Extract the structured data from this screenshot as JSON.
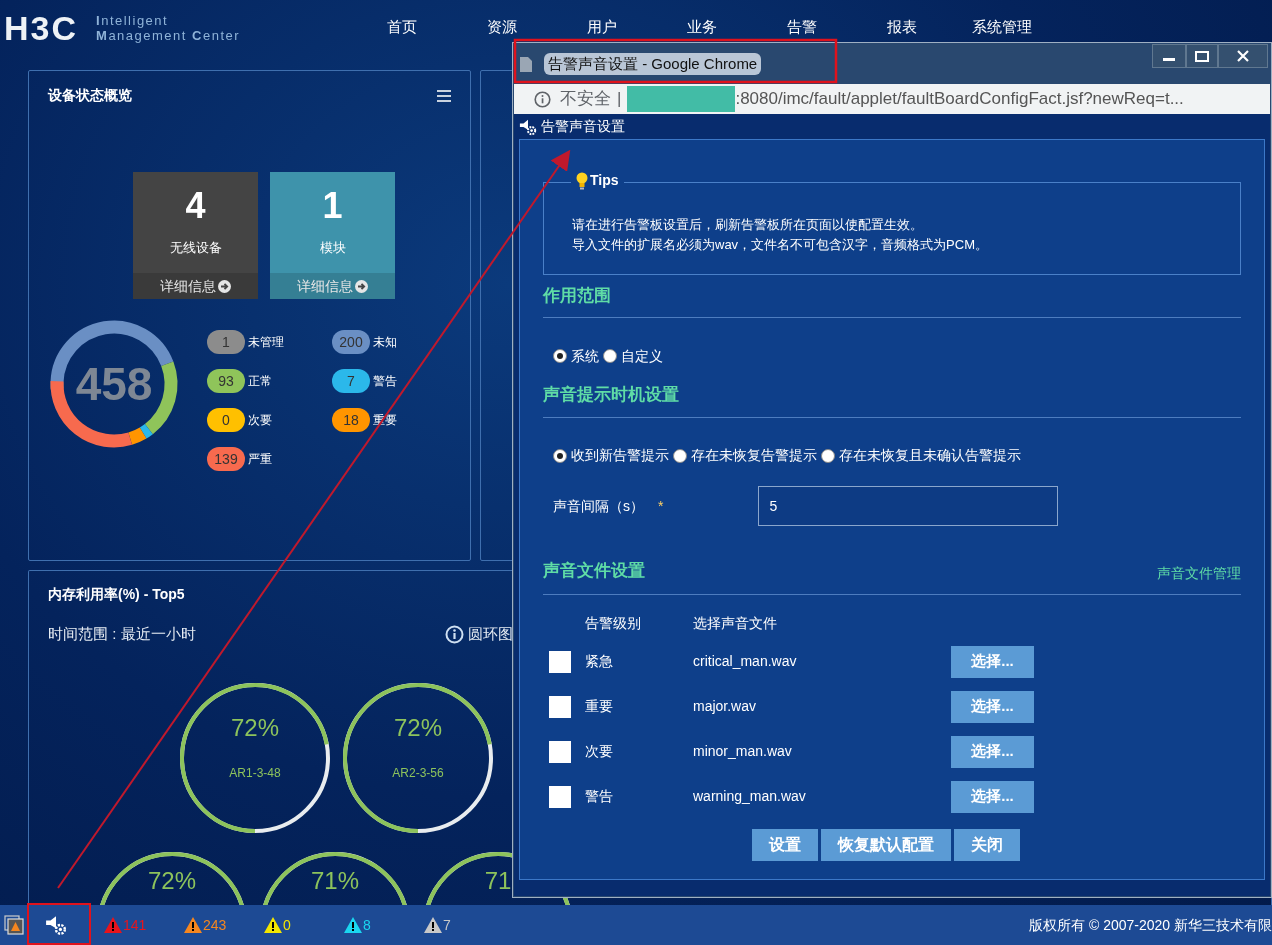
{
  "header": {
    "logo": "H3C",
    "product_lines": [
      "**I**ntelligent",
      "**M**anagement **C**enter"
    ],
    "nav": [
      "首页",
      "资源",
      "用户",
      "业务",
      "告警",
      "报表",
      "系统管理"
    ]
  },
  "device_overview": {
    "title": "设备状态概览",
    "tiles": [
      {
        "count": "4",
        "label": "无线设备",
        "link": "详细信息",
        "color": "#444444"
      },
      {
        "count": "1",
        "label": "模块",
        "link": "详细信息",
        "color": "#3e93ab"
      }
    ],
    "total": "458",
    "legend": [
      {
        "count": "1",
        "label": "未管理",
        "color": "#8c8c8c"
      },
      {
        "count": "200",
        "label": "未知",
        "color": "#6a8fc4"
      },
      {
        "count": "93",
        "label": "正常",
        "color": "#8fc45a"
      },
      {
        "count": "7",
        "label": "警告",
        "color": "#2bb8ea"
      },
      {
        "count": "0",
        "label": "次要",
        "color": "#ffc000"
      },
      {
        "count": "18",
        "label": "重要",
        "color": "#ff9500"
      },
      {
        "count": "139",
        "label": "严重",
        "color": "#f76a4e"
      }
    ]
  },
  "memory_panel": {
    "title": "内存利用率(%) - Top5",
    "time_range": "时间范围 : 最近一小时",
    "view_toggle": "圆环图",
    "gauge_rows": [
      [
        {
          "percent": "72%",
          "label": "AR1-3-48"
        },
        {
          "percent": "72%",
          "label": "AR2-3-56"
        }
      ],
      [
        {
          "percent": "72%"
        },
        {
          "percent": "71%"
        },
        {
          "percent": "71"
        }
      ]
    ]
  },
  "status_bar": {
    "alarms": [
      {
        "count": "141",
        "color": "#e8141c"
      },
      {
        "count": "243",
        "color": "#f5861f"
      },
      {
        "count": "0",
        "color": "#f2e600"
      },
      {
        "count": "8",
        "color": "#1ad6f0"
      },
      {
        "count": "7",
        "color": "#c8c8c8"
      }
    ],
    "copyright": "版权所有 © 2007-2020 新华三技术有限"
  },
  "popup": {
    "window_title": "告警声音设置 - Google Chrome",
    "address": {
      "security": "不安全",
      "separator": "|",
      "url": ":8080/imc/fault/applet/faultBoardConfigFact.jsf?newReq=t..."
    },
    "page_title": "告警声音设置",
    "tips": {
      "title": "Tips",
      "lines": [
        "请在进行告警板设置后，刷新告警板所在页面以使配置生效。",
        "导入文件的扩展名必须为wav，文件名不可包含汉字，音频格式为PCM。"
      ]
    },
    "scope": {
      "heading": "作用范围",
      "options": [
        {
          "label": "系统",
          "selected": true
        },
        {
          "label": "自定义",
          "selected": false
        }
      ]
    },
    "timing": {
      "heading": "声音提示时机设置",
      "options": [
        {
          "label": "收到新告警提示",
          "selected": true
        },
        {
          "label": "存在未恢复告警提示",
          "selected": false
        },
        {
          "label": "存在未恢复且未确认告警提示",
          "selected": false
        }
      ],
      "interval": {
        "label": "声音间隔（s）",
        "required_mark": "*",
        "value": "5"
      }
    },
    "files": {
      "heading": "声音文件设置",
      "manage_link": "声音文件管理",
      "columns": [
        "告警级别",
        "选择声音文件"
      ],
      "rows": [
        {
          "checked": false,
          "level": "紧急",
          "file": "critical_man.wav",
          "button": "选择..."
        },
        {
          "checked": false,
          "level": "重要",
          "file": "major.wav",
          "button": "选择..."
        },
        {
          "checked": false,
          "level": "次要",
          "file": "minor_man.wav",
          "button": "选择..."
        },
        {
          "checked": false,
          "level": "警告",
          "file": "warning_man.wav",
          "button": "选择..."
        }
      ]
    },
    "actions": [
      "设置",
      "恢复默认配置",
      "关闭"
    ]
  }
}
